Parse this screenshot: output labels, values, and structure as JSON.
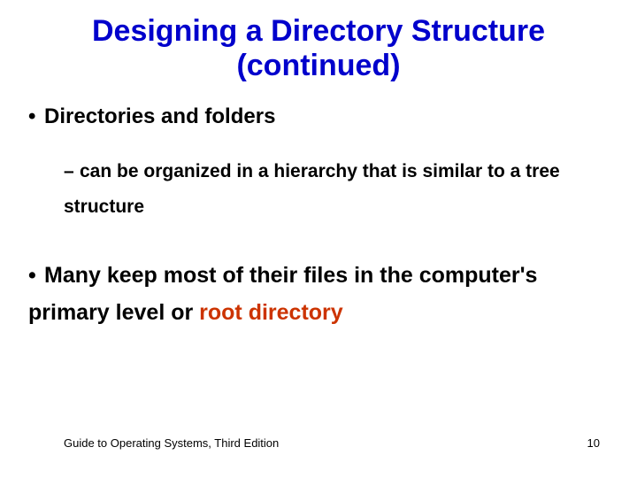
{
  "title": "Designing a Directory Structure (continued)",
  "bullets": {
    "main1": "Directories and folders",
    "sub1": "can be organized in a hierarchy that is similar to a tree structure",
    "main2_pre": "Many keep most of their files in the computer's primary level or ",
    "main2_hl": "root directory"
  },
  "footer": {
    "left": "Guide to Operating Systems, Third Edition",
    "right": "10"
  }
}
